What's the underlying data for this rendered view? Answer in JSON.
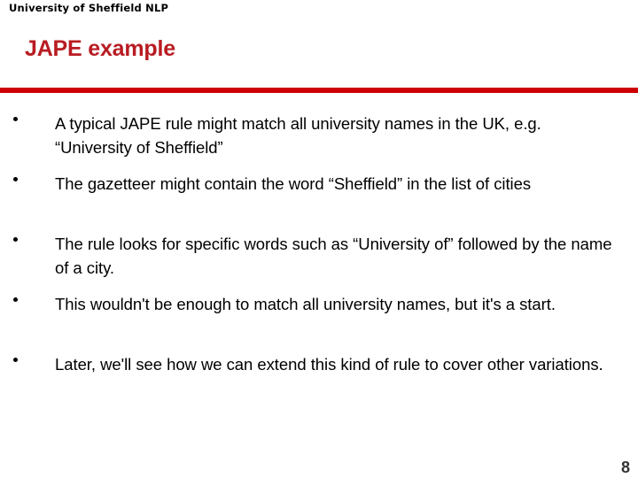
{
  "slide": {
    "org_header": "University of Sheffield NLP",
    "title": "JAPE example",
    "accent_color": "#cc0000",
    "title_color": "#b81c22",
    "page_number": "8",
    "bullets": [
      {
        "marker": "bullet-dot",
        "text": "A typical JAPE rule might match all university names in the UK, e.g. “University of Sheffield”"
      },
      {
        "marker": "bullet-dot",
        "text": "The gazetteer might contain the word “Sheffield” in the list of cities"
      },
      {
        "marker": "bullet-dot",
        "text": "The rule looks for specific words such as “University of” followed by the name of a city."
      },
      {
        "marker": "bullet-dot",
        "text": "This wouldn't be enough to match all university names, but it's a start."
      },
      {
        "marker": "bullet-dot",
        "text": "Later, we'll see how we can extend this kind of rule to cover other variations."
      }
    ]
  }
}
